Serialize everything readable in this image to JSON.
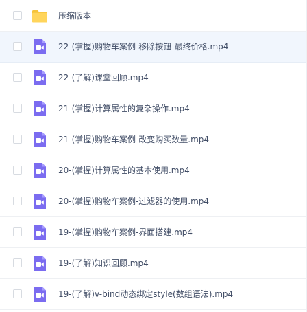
{
  "colors": {
    "folder": "#ffd55c",
    "video_icon": "#7b6cf0",
    "hover_row": "#f1f6fd",
    "text": "#424e67"
  },
  "files": [
    {
      "name": "压缩版本",
      "icon": "folder-icon",
      "hovered": false
    },
    {
      "name": "22-(掌握)购物车案例-移除按钮-最终价格.mp4",
      "icon": "video-file-icon",
      "hovered": true
    },
    {
      "name": "22-(了解)课堂回顾.mp4",
      "icon": "video-file-icon",
      "hovered": false
    },
    {
      "name": "21-(掌握)计算属性的复杂操作.mp4",
      "icon": "video-file-icon",
      "hovered": false
    },
    {
      "name": "21-(掌握)购物车案例-改变购买数量.mp4",
      "icon": "video-file-icon",
      "hovered": false
    },
    {
      "name": "20-(掌握)计算属性的基本使用.mp4",
      "icon": "video-file-icon",
      "hovered": false
    },
    {
      "name": "20-(掌握)购物车案例-过滤器的使用.mp4",
      "icon": "video-file-icon",
      "hovered": false
    },
    {
      "name": "19-(掌握)购物车案例-界面搭建.mp4",
      "icon": "video-file-icon",
      "hovered": false
    },
    {
      "name": "19-(了解)知识回顾.mp4",
      "icon": "video-file-icon",
      "hovered": false
    },
    {
      "name": "19-(了解)v-bind动态绑定style(数组语法).mp4",
      "icon": "video-file-icon",
      "hovered": false
    }
  ]
}
